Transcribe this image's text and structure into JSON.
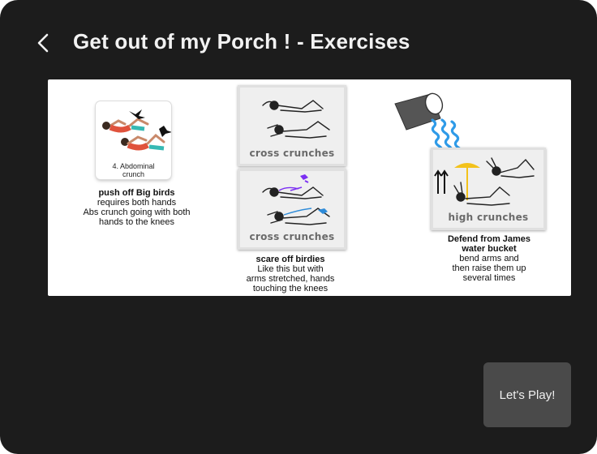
{
  "header": {
    "title": "Get out of my Porch ! - Exercises",
    "back_icon": "chevron-left-icon"
  },
  "exercises": {
    "ab_card_caption": "4. Abdominal crunch",
    "cross_crunches_label_1": "cross crunches",
    "cross_crunches_label_2": "cross crunches",
    "high_crunches_label": "high crunches",
    "left": {
      "title": "push off Big birds",
      "lines": [
        "requires both hands",
        "Abs crunch going with both",
        "hands to the knees"
      ]
    },
    "middle": {
      "title": "scare off birdies",
      "lines": [
        "Like this but with",
        "arms stretched, hands",
        "touching the knees"
      ]
    },
    "right": {
      "title_lines": [
        "Defend from James",
        "water bucket"
      ],
      "lines": [
        "bend arms and",
        "then raise them up",
        "several times"
      ]
    }
  },
  "play_button": {
    "label": "Let's Play!"
  },
  "colors": {
    "background": "#1c1c1c",
    "title": "#f2f2f2",
    "button": "#4a4a4a",
    "bird_purple": "#7b2ff2",
    "bird_blue": "#2e8bd8",
    "water": "#2f9be8",
    "umbrella": "#f3c21b"
  }
}
